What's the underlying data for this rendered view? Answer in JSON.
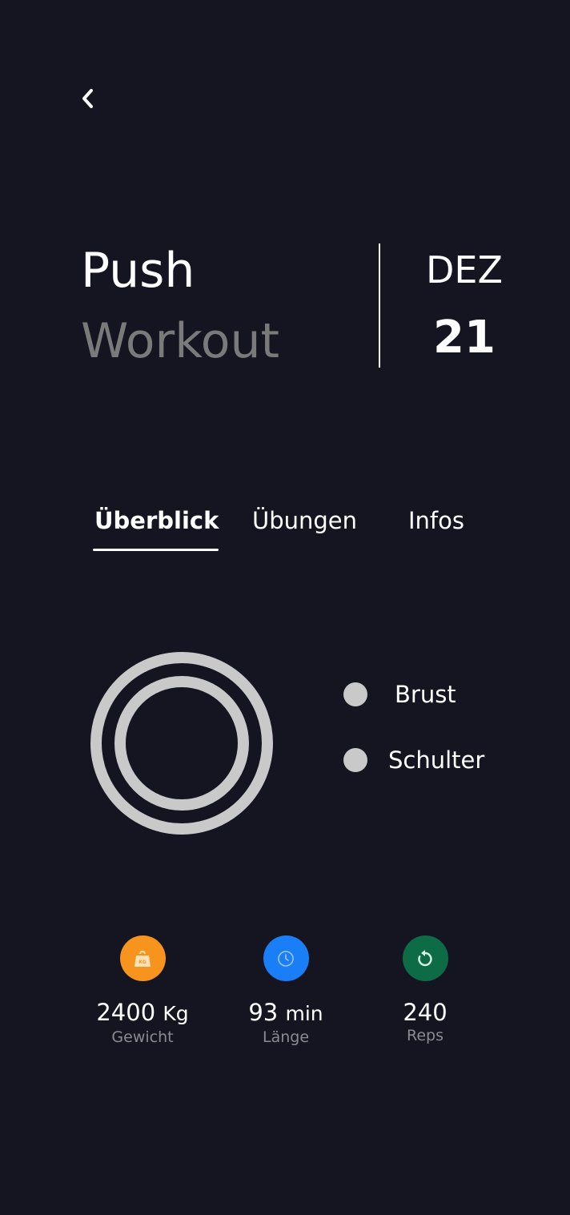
{
  "header": {
    "back_icon": "chevron-left-icon"
  },
  "workout": {
    "title_line1": "Push",
    "title_line2": "Workout"
  },
  "date": {
    "month": "DEZ",
    "day": "21"
  },
  "tabs": [
    {
      "label": "Überblick",
      "active": true
    },
    {
      "label": "Übungen",
      "active": false
    },
    {
      "label": "Infos",
      "active": false
    }
  ],
  "muscle_chart": {
    "ring_color": "#c9c9c9",
    "legend": [
      {
        "label": "Brust"
      },
      {
        "label": "Schulter"
      }
    ]
  },
  "stats": [
    {
      "value": "2400",
      "unit": "Kg",
      "label": "Gewicht",
      "icon": "weight-icon",
      "color": "#f7941d"
    },
    {
      "value": "93",
      "unit": "min",
      "label": "Länge",
      "icon": "clock-icon",
      "color": "#1a7ef7"
    },
    {
      "value": "240",
      "unit": "",
      "label": "Reps",
      "icon": "repeat-icon",
      "color": "#0d6b45"
    }
  ],
  "colors": {
    "background": "#151522",
    "title_secondary": "#7a7a7a",
    "label_muted": "#8a8a8f"
  }
}
